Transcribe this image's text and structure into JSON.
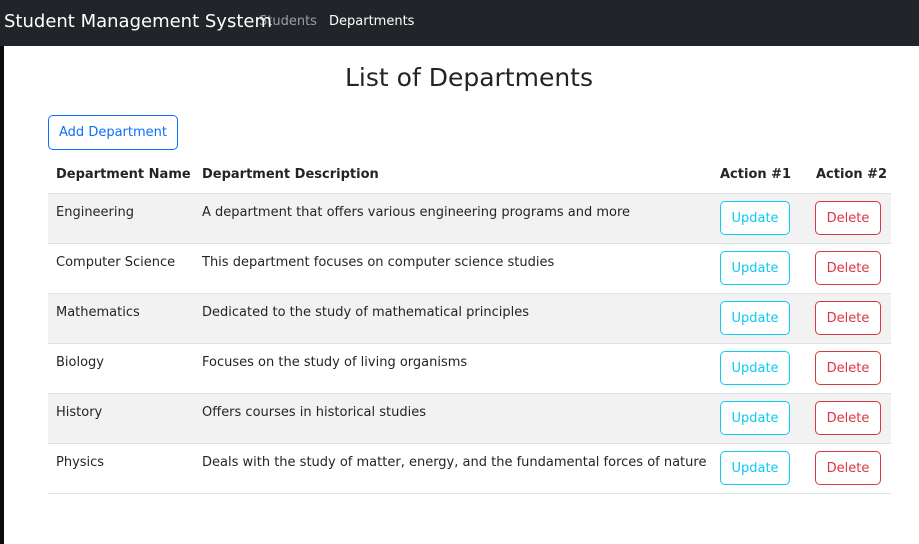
{
  "navbar": {
    "brand": "Student Management System",
    "links": [
      "Students",
      "Departments"
    ],
    "active": "Departments"
  },
  "page": {
    "title": "List of Departments",
    "add_button": "Add Department"
  },
  "table": {
    "headers": [
      "Department Name",
      "Department Description",
      "Action #1",
      "Action #2"
    ],
    "update_label": "Update",
    "delete_label": "Delete",
    "rows": [
      {
        "name": "Engineering",
        "description": "A department that offers various engineering programs and more"
      },
      {
        "name": "Computer Science",
        "description": "This department focuses on computer science studies"
      },
      {
        "name": "Mathematics",
        "description": "Dedicated to the study of mathematical principles"
      },
      {
        "name": "Biology",
        "description": "Focuses on the study of living organisms"
      },
      {
        "name": "History",
        "description": "Offers courses in historical studies"
      },
      {
        "name": "Physics",
        "description": "Deals with the study of matter, energy, and the fundamental forces of nature"
      }
    ]
  },
  "colors": {
    "navbar_bg": "#212529",
    "primary": "#0d6efd",
    "info": "#0dcaf0",
    "danger": "#dc3545",
    "stripe": "#f2f2f2"
  }
}
